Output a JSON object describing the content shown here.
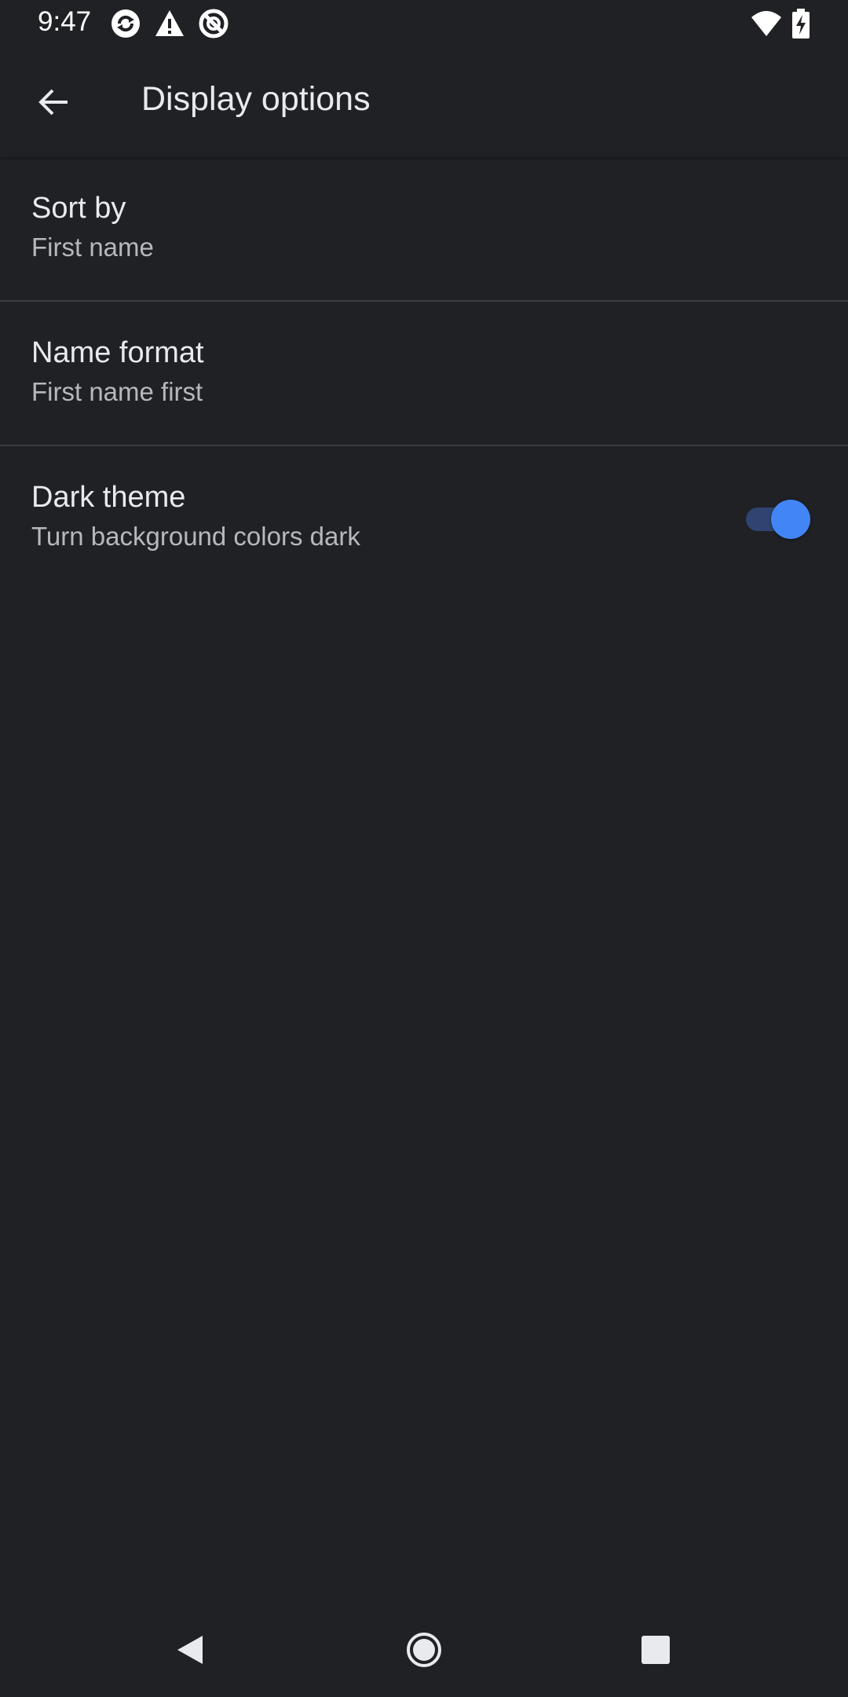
{
  "status_bar": {
    "time": "9:47",
    "icons": [
      "sync-icon",
      "warning-icon",
      "no-disturb-icon",
      "wifi-icon",
      "battery-charging-icon"
    ]
  },
  "app_bar": {
    "title": "Display options",
    "back_icon": "arrow-back-icon"
  },
  "settings": [
    {
      "title": "Sort by",
      "summary": "First name"
    },
    {
      "title": "Name format",
      "summary": "First name first"
    },
    {
      "title": "Dark theme",
      "summary": "Turn background colors dark",
      "toggle_on": true
    }
  ],
  "nav_bar": {
    "buttons": [
      "nav-back-icon",
      "nav-home-icon",
      "nav-recents-icon"
    ]
  },
  "colors": {
    "background": "#202125",
    "accent": "#4285f4",
    "toggle_track": "#2f4470",
    "primary_text": "#e8eaed",
    "secondary_text": "#b6b8bc",
    "divider": "#3c3d41"
  }
}
